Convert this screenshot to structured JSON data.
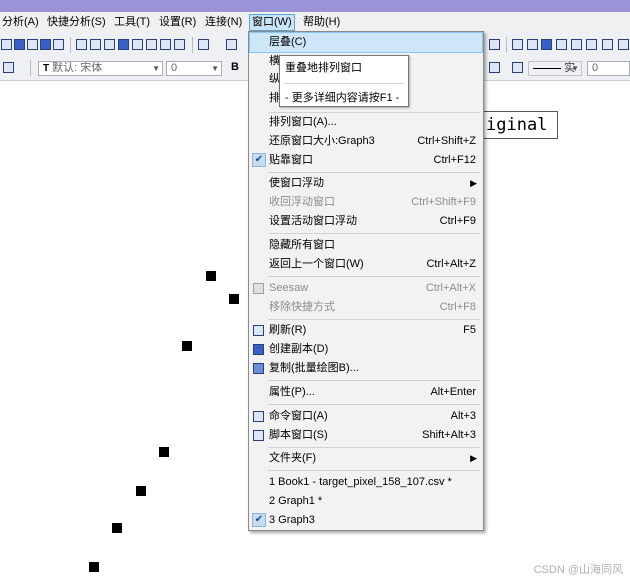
{
  "menubar": {
    "items": [
      "分析(A)",
      "快捷分析(S)",
      "工具(T)",
      "设置(R)",
      "连接(N)",
      "窗口(W)",
      "帮助(H)"
    ]
  },
  "toolbar2": {
    "font_name": "默认: 宋体",
    "font_size": "0",
    "bold": "B",
    "line_style": "实",
    "line_width": "0"
  },
  "graph": {
    "legend_text": "iginal"
  },
  "window_menu": {
    "items": [
      {
        "label": "层叠(C)",
        "shortcut": ""
      },
      {
        "label": "横",
        "shortcut": ""
      },
      {
        "label": "纵",
        "shortcut": ""
      },
      {
        "label": "排",
        "shortcut": ""
      },
      {
        "label": "排列窗口(A)...",
        "shortcut": ""
      },
      {
        "label": "还原窗口大小:Graph3",
        "shortcut": "Ctrl+Shift+Z"
      },
      {
        "label": "贴靠窗口",
        "shortcut": "Ctrl+F12"
      },
      {
        "label": "使窗口浮动",
        "shortcut": ""
      },
      {
        "label": "收回浮动窗口",
        "shortcut": "Ctrl+Shift+F9"
      },
      {
        "label": "设置活动窗口浮动",
        "shortcut": "Ctrl+F9"
      },
      {
        "label": "隐藏所有窗口",
        "shortcut": ""
      },
      {
        "label": "返回上一个窗口(W)",
        "shortcut": "Ctrl+Alt+Z"
      },
      {
        "label": "Seesaw",
        "shortcut": "Ctrl+Alt+X"
      },
      {
        "label": "移除快捷方式",
        "shortcut": "Ctrl+F8"
      },
      {
        "label": "刷新(R)",
        "shortcut": "F5"
      },
      {
        "label": "创建副本(D)",
        "shortcut": ""
      },
      {
        "label": "复制(批量绘图B)...",
        "shortcut": ""
      },
      {
        "label": "属性(P)...",
        "shortcut": "Alt+Enter"
      },
      {
        "label": "命令窗口(A)",
        "shortcut": "Alt+3"
      },
      {
        "label": "脚本窗口(S)",
        "shortcut": "Shift+Alt+3"
      },
      {
        "label": "文件夹(F)",
        "shortcut": ""
      },
      {
        "label": "1 Book1 - target_pixel_158_107.csv *",
        "shortcut": ""
      },
      {
        "label": "2 Graph1 *",
        "shortcut": ""
      },
      {
        "label": "3 Graph3",
        "shortcut": ""
      }
    ]
  },
  "tooltip": {
    "title": "重叠地排列窗口",
    "hint": "- 更多详细内容请按F1 -"
  },
  "watermark": "CSDN @山海同风"
}
